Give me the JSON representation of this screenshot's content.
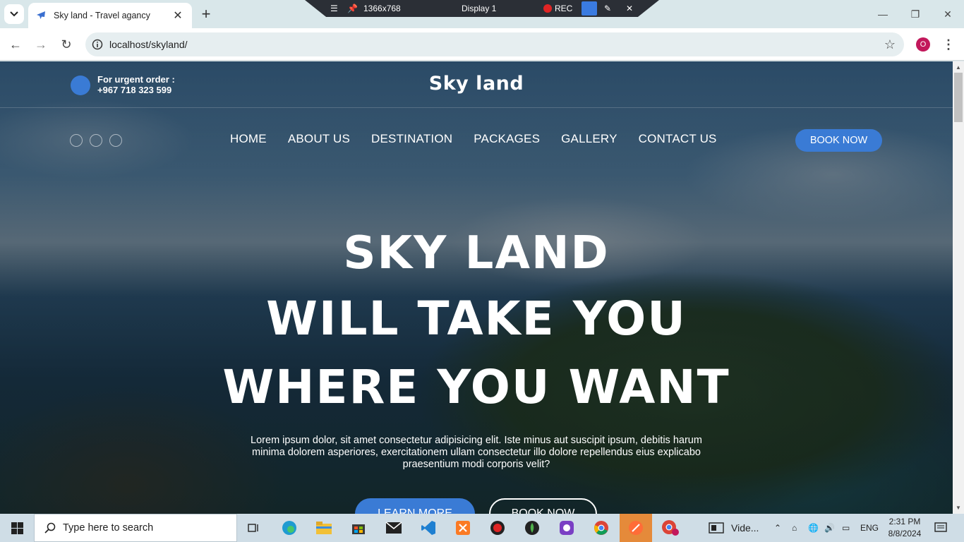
{
  "browser": {
    "tab_title": "Sky land - Travel agancy",
    "url": "localhost/skyland/",
    "profile_initial": "O"
  },
  "recorder": {
    "resolution": "1366x768",
    "display": "Display 1",
    "rec_label": "REC"
  },
  "site": {
    "urgent_label": "For urgent order :",
    "urgent_phone": "+967 718 323 599",
    "brand": "Sky land",
    "nav": [
      "HOME",
      "ABOUT US",
      "DESTINATION",
      "PACKAGES",
      "GALLERY",
      "CONTACT US"
    ],
    "book_now_top": "BOOK NOW",
    "hero_line1": "SKY LAND",
    "hero_line2": "WILL TAKE YOU",
    "hero_line3": "WHERE YOU WANT",
    "hero_text": "Lorem ipsum dolor, sit amet consectetur adipisicing elit. Iste minus aut suscipit ipsum, debitis harum minima dolorem asperiores, exercitationem ullam consectetur illo dolore repellendus eius explicabo praesentium modi corporis velit?",
    "cta_learn": "LEARN MORE",
    "cta_book": "BOOK NOW"
  },
  "taskbar": {
    "search_placeholder": "Type here to search",
    "video_label": "Vide...",
    "language": "ENG",
    "time": "2:31 PM",
    "date": "8/8/2024",
    "chrome_badge": "0"
  },
  "colors": {
    "accent": "#3a7bd5",
    "tab_bg": "#d9e7ea",
    "taskbar_bg": "#cfdde6"
  }
}
